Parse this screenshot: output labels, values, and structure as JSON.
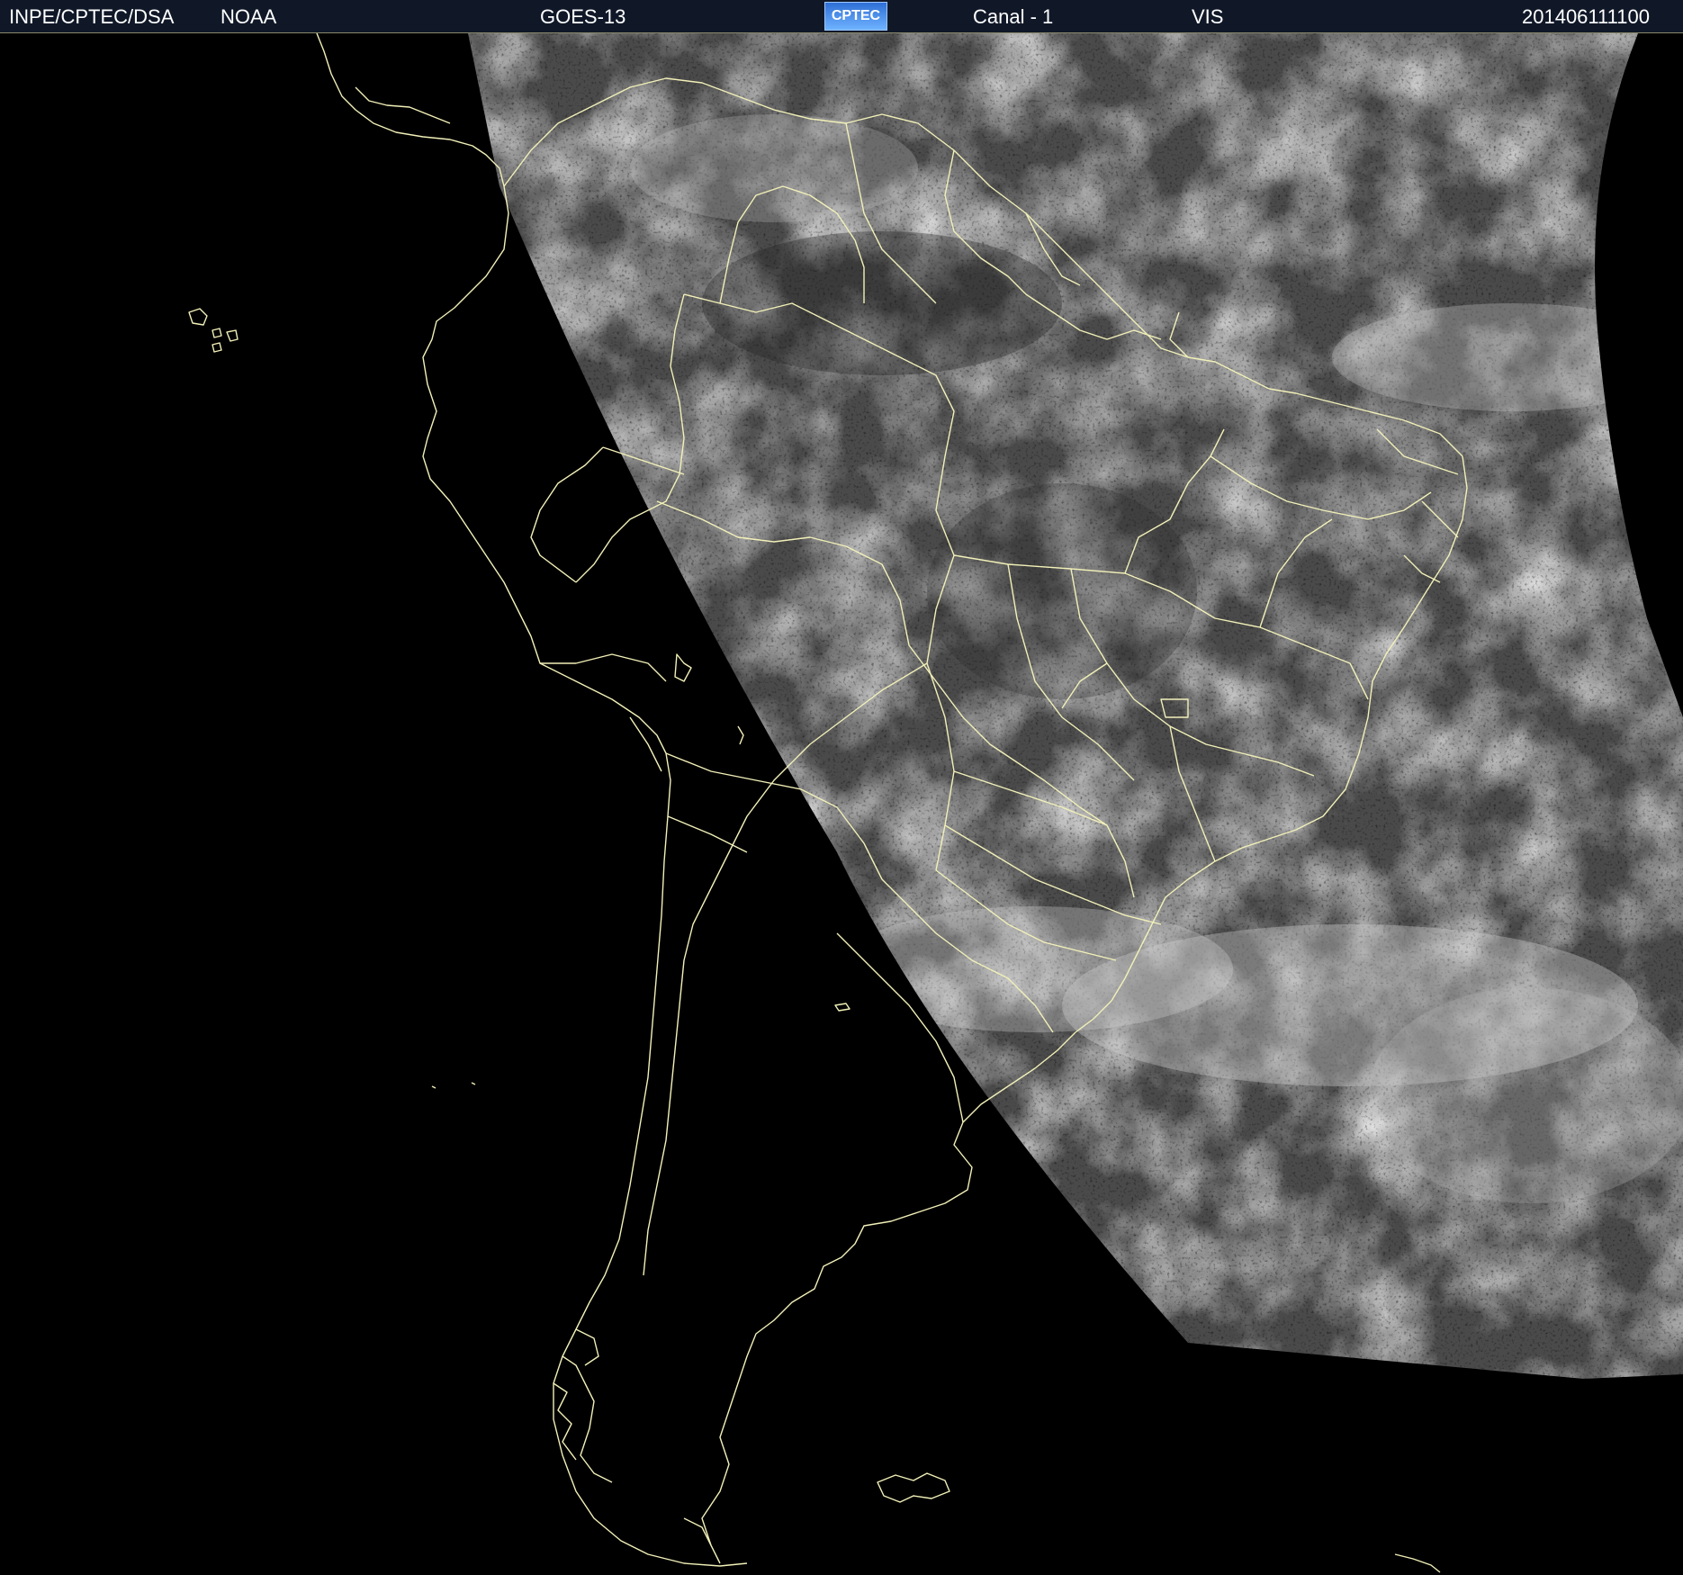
{
  "header": {
    "institution": "INPE/CPTEC/DSA",
    "agency": "NOAA",
    "satellite": "GOES-13",
    "logo_text": "CPTEC",
    "channel": "Canal - 1",
    "band": "VIS",
    "timestamp": "201406111100"
  },
  "colors": {
    "header_bg": "#101828",
    "border_lines": "#f2f0b8",
    "space": "#000000"
  },
  "icons": {
    "logo": "cptec-logo-icon"
  }
}
